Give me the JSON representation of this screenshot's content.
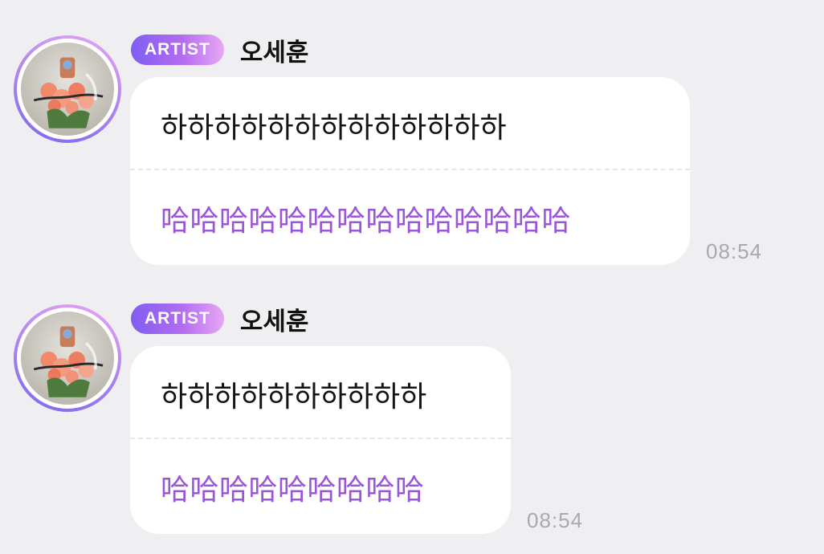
{
  "colors": {
    "background": "#efeff2",
    "bubble": "#ffffff",
    "translation_text": "#9a55d8",
    "badge_gradient_start": "#7f5ef2",
    "badge_gradient_end": "#e7a7f4",
    "timestamp": "#a9a9ae"
  },
  "messages": [
    {
      "avatar_icon": "profile-photo-flower-bouquet",
      "badge": "ARTIST",
      "sender": "오세훈",
      "original": "하하하하하하하하하하하하하",
      "translation": "哈哈哈哈哈哈哈哈哈哈哈哈哈哈",
      "time": "08:54"
    },
    {
      "avatar_icon": "profile-photo-flower-bouquet",
      "badge": "ARTIST",
      "sender": "오세훈",
      "original": "하하하하하하하하하하",
      "translation": "哈哈哈哈哈哈哈哈哈",
      "time": "08:54"
    }
  ]
}
